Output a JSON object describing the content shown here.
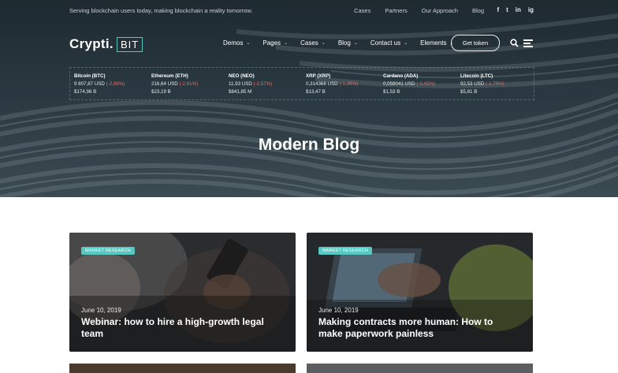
{
  "topbar": {
    "tagline": "Serving blockchain users today, making blockchain a reality tomorrow.",
    "links": [
      "Cases",
      "Partners",
      "Our Approach",
      "Blog"
    ],
    "social": [
      "f",
      "t",
      "in",
      "ig"
    ]
  },
  "header": {
    "logo_text": "Crypti.",
    "logo_badge": "BIT",
    "nav": [
      "Demos",
      "Pages",
      "Cases",
      "Blog",
      "Contact us",
      "Elements"
    ],
    "cta": "Get token"
  },
  "ticker": [
    {
      "name": "Bitcoin (BTC)",
      "price": "9 807,87 USD",
      "change": "(-2,88%)",
      "cap": "$174,96 B"
    },
    {
      "name": "Ethereum (ETH)",
      "price": "216,64 USD",
      "change": "(-2,61%)",
      "cap": "$23,19 B"
    },
    {
      "name": "NEO (NEO)",
      "price": "11,93 USD",
      "change": "(-2,57%)",
      "cap": "$841,85 M"
    },
    {
      "name": "XRP (XRP)",
      "price": "0,314368 USD",
      "change": "(-1,26%)",
      "cap": "$13,47 B"
    },
    {
      "name": "Cardano (ADA)",
      "price": "0,059041 USD",
      "change": "(-0,43%)",
      "cap": "$1,53 B"
    },
    {
      "name": "Litecoin (LTC)",
      "price": "92,53 USD",
      "change": "(-1,75%)",
      "cap": "$5,81 B"
    }
  ],
  "page_title": "Modern Blog",
  "cards": [
    {
      "tag": "MARKET RESEARCH",
      "date": "June 10, 2019",
      "title": "Webinar: how to hire a high-growth legal team"
    },
    {
      "tag": "MARKET RESEARCH",
      "date": "June 10, 2019",
      "title": "Making contracts more human: How to make paperwork painless"
    }
  ],
  "colors": {
    "accent": "#58c9c2",
    "hero_bg": "#2b3a42",
    "negative": "#e86b6b"
  }
}
